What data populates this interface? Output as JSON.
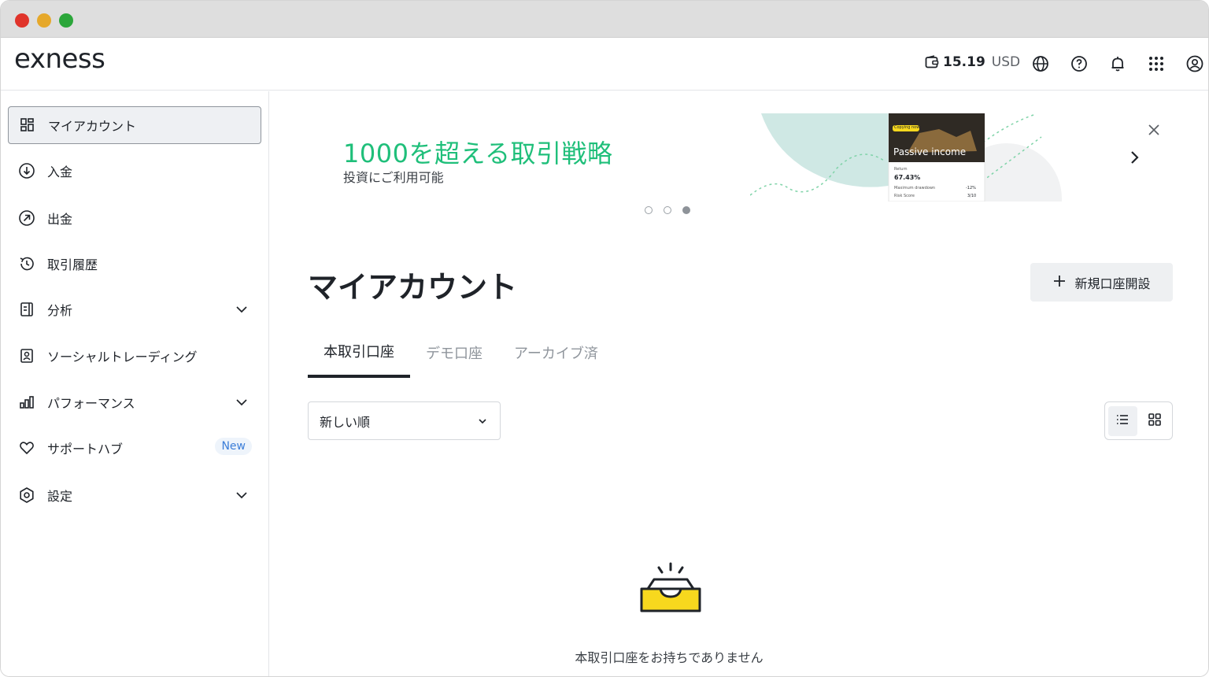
{
  "window": {
    "controls": [
      "close",
      "minimize",
      "maximize"
    ]
  },
  "header": {
    "logo": "exness",
    "balance_amount": "15.19",
    "balance_currency": "USD",
    "icons": [
      "wallet-icon",
      "globe-icon",
      "help-icon",
      "bell-icon",
      "apps-grid-icon",
      "profile-icon"
    ]
  },
  "sidebar": {
    "items": [
      {
        "label": "マイアカウント",
        "icon": "dashboard-icon",
        "active": true
      },
      {
        "label": "入金",
        "icon": "deposit-icon"
      },
      {
        "label": "出金",
        "icon": "withdraw-icon"
      },
      {
        "label": "取引履歴",
        "icon": "history-icon"
      },
      {
        "label": "分析",
        "icon": "analytics-icon",
        "expandable": true
      },
      {
        "label": "ソーシャルトレーディング",
        "icon": "social-trading-icon"
      },
      {
        "label": "パフォーマンス",
        "icon": "performance-icon",
        "expandable": true
      },
      {
        "label": "サポートハブ",
        "icon": "heart-icon",
        "badge": "New"
      },
      {
        "label": "設定",
        "icon": "settings-icon",
        "expandable": true
      }
    ]
  },
  "banner": {
    "title": "1000を超える取引戦略",
    "subtitle": "投資にご利用可能",
    "card_title": "Passive income",
    "card_tag": "Copying now",
    "card_return_label": "Return",
    "card_return_value": "67.43%",
    "card_drawdown_label": "Maximum drawdown",
    "card_drawdown_value": "-12%",
    "card_risk_label": "Risk Score",
    "card_risk_value": "3/10",
    "slides": 3,
    "active_slide": 3
  },
  "main": {
    "title": "マイアカウント",
    "new_account_button": "新規口座開設",
    "tabs": [
      {
        "label": "本取引口座",
        "active": true
      },
      {
        "label": "デモ口座"
      },
      {
        "label": "アーカイブ済"
      }
    ],
    "sort_value": "新しい順",
    "view_modes": [
      "list-view",
      "grid-view"
    ],
    "active_view": "list-view",
    "empty_message": "本取引口座をお持ちでありません"
  },
  "colors": {
    "accent_green": "#1fbf7a",
    "accent_yellow": "#f7d81e",
    "text_primary": "#1f2329",
    "badge_blue": "#3b7dd8"
  }
}
